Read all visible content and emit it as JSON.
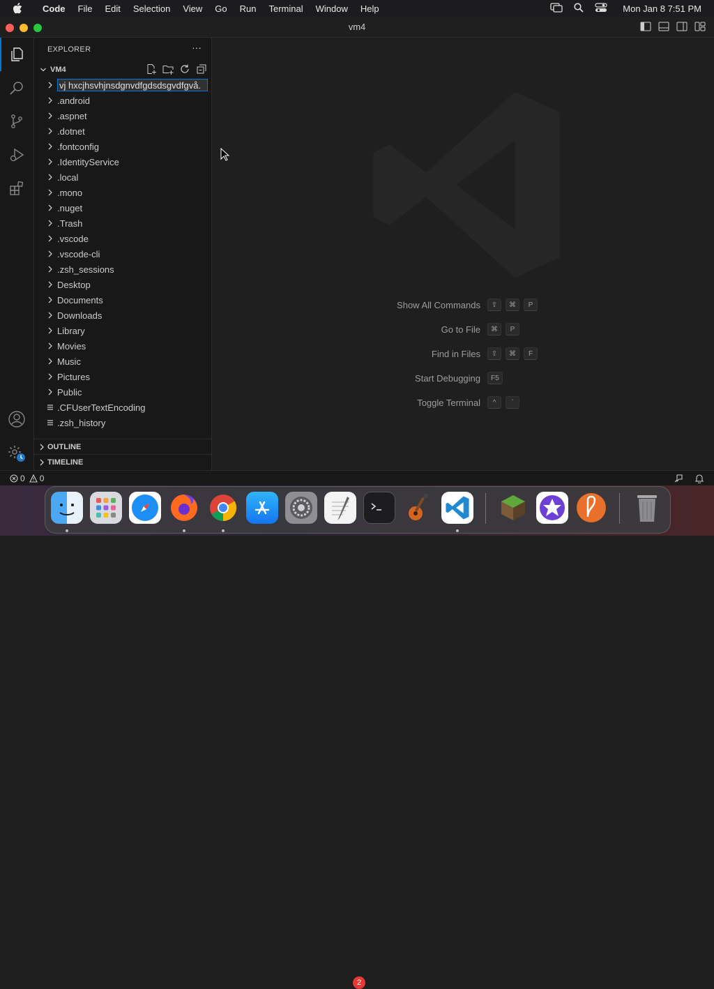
{
  "menubar": {
    "app": "Code",
    "items": [
      "File",
      "Edit",
      "Selection",
      "View",
      "Go",
      "Run",
      "Terminal",
      "Window",
      "Help"
    ],
    "clock": "Mon Jan 8  7:51 PM"
  },
  "window": {
    "title": "vm4"
  },
  "sidebar": {
    "header": "EXPLORER",
    "more": "···",
    "folder": "VM4",
    "editing_value": "vj hxcjhsvhjnsdgnvdfgdsdsgvdfgvå.",
    "tree": [
      {
        "label": ".android",
        "kind": "folder"
      },
      {
        "label": ".aspnet",
        "kind": "folder"
      },
      {
        "label": ".dotnet",
        "kind": "folder"
      },
      {
        "label": ".fontconfig",
        "kind": "folder"
      },
      {
        "label": ".IdentityService",
        "kind": "folder"
      },
      {
        "label": ".local",
        "kind": "folder"
      },
      {
        "label": ".mono",
        "kind": "folder"
      },
      {
        "label": ".nuget",
        "kind": "folder"
      },
      {
        "label": ".Trash",
        "kind": "folder"
      },
      {
        "label": ".vscode",
        "kind": "folder"
      },
      {
        "label": ".vscode-cli",
        "kind": "folder"
      },
      {
        "label": ".zsh_sessions",
        "kind": "folder"
      },
      {
        "label": "Desktop",
        "kind": "folder"
      },
      {
        "label": "Documents",
        "kind": "folder"
      },
      {
        "label": "Downloads",
        "kind": "folder"
      },
      {
        "label": "Library",
        "kind": "folder"
      },
      {
        "label": "Movies",
        "kind": "folder"
      },
      {
        "label": "Music",
        "kind": "folder"
      },
      {
        "label": "Pictures",
        "kind": "folder"
      },
      {
        "label": "Public",
        "kind": "folder"
      },
      {
        "label": ".CFUserTextEncoding",
        "kind": "file"
      },
      {
        "label": ".zsh_history",
        "kind": "file"
      }
    ],
    "outline": "OUTLINE",
    "timeline": "TIMELINE"
  },
  "editor": {
    "commands": [
      {
        "label": "Show All Commands",
        "keys": [
          "⇧",
          "⌘",
          "P"
        ]
      },
      {
        "label": "Go to File",
        "keys": [
          "⌘",
          "P"
        ]
      },
      {
        "label": "Find in Files",
        "keys": [
          "⇧",
          "⌘",
          "F"
        ]
      },
      {
        "label": "Start Debugging",
        "keys": [
          "F5"
        ]
      },
      {
        "label": "Toggle Terminal",
        "keys": [
          "^",
          "`"
        ]
      }
    ]
  },
  "statusbar": {
    "errors": "0",
    "warnings": "0"
  },
  "dock": {
    "apps": [
      "Finder",
      "Launchpad",
      "Safari",
      "Firefox",
      "Chrome",
      "App Store",
      "System Settings",
      "TextEdit",
      "Terminal",
      "GarageBand",
      "Visual Studio Code",
      "Minecraft",
      "iMovie",
      "Scrobbler",
      "Trash"
    ],
    "settings_badge": "2"
  },
  "colors": {
    "accent": "#0078d4",
    "background": "#1f1f1f",
    "sidebar": "#181818"
  }
}
